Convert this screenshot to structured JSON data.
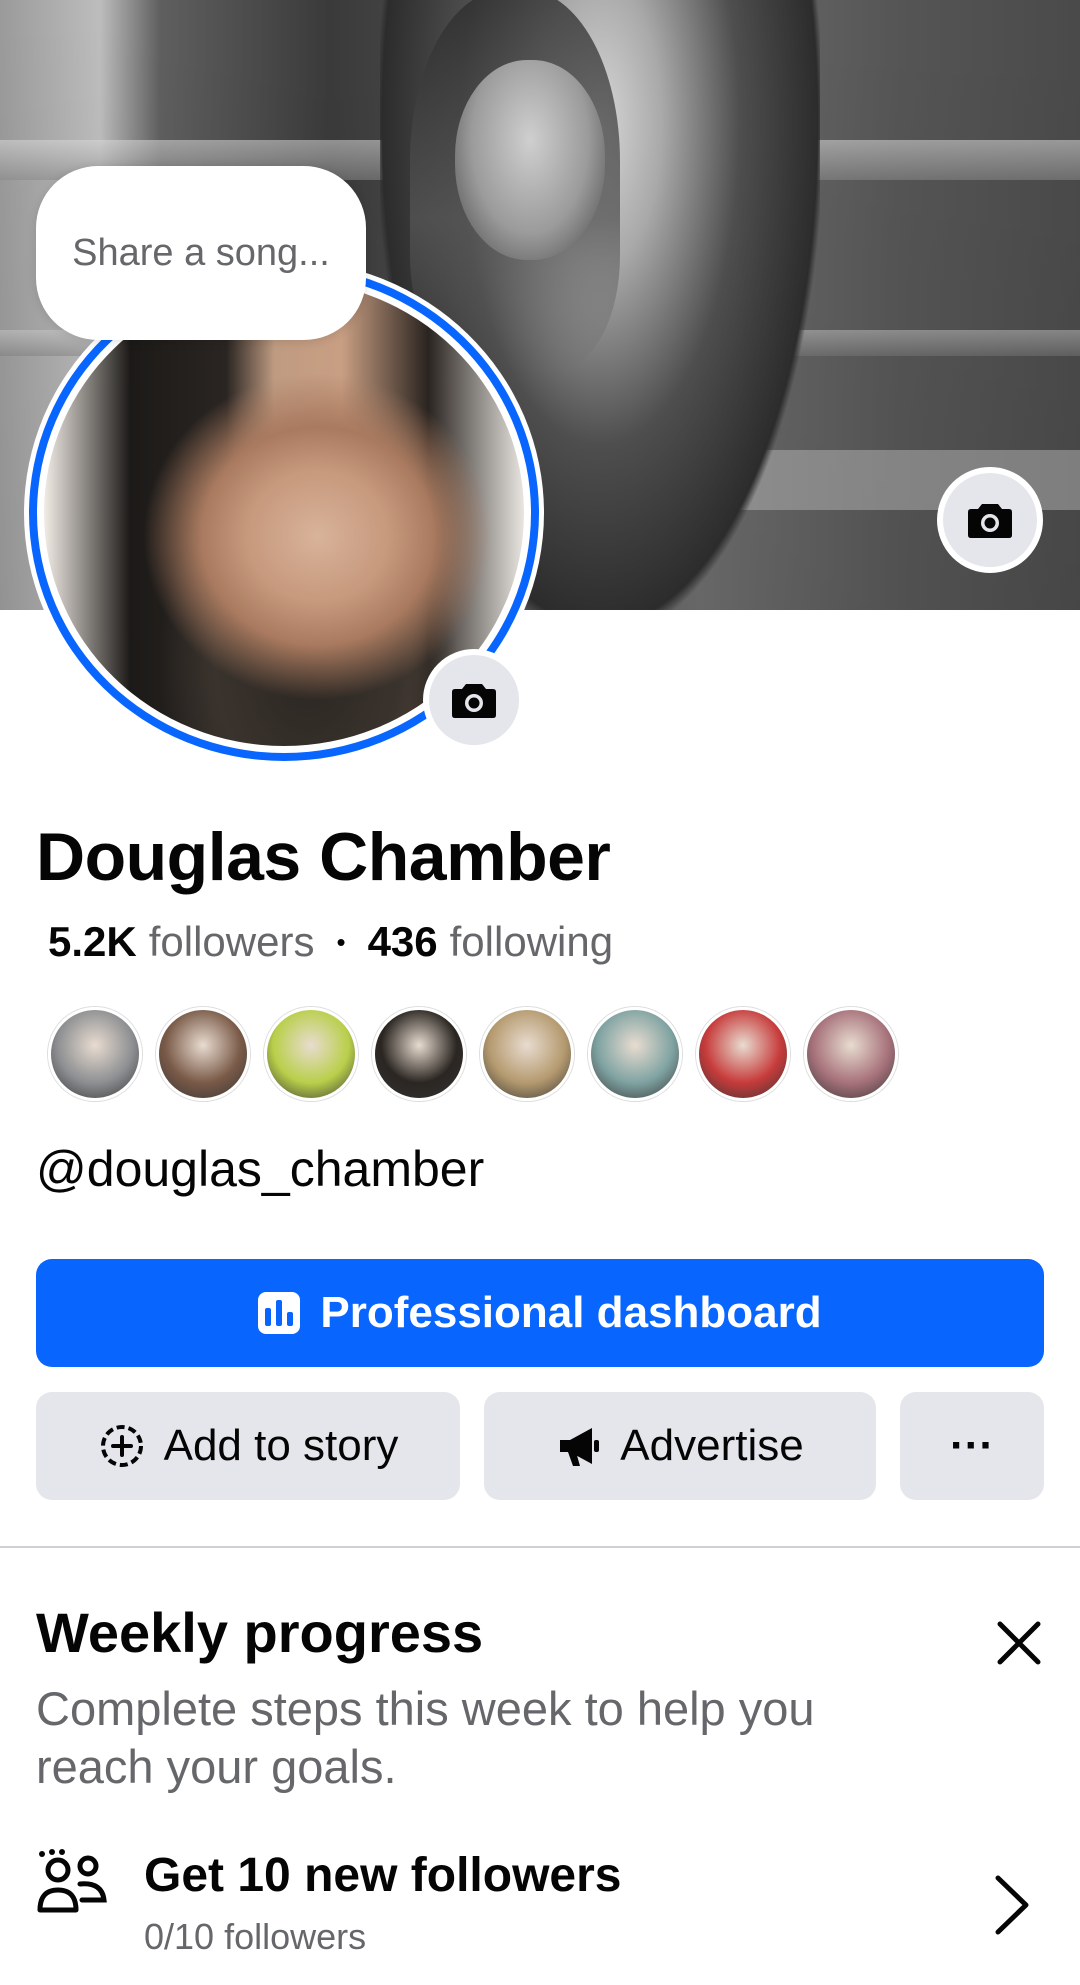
{
  "profile": {
    "note_placeholder": "Share a song...",
    "name": "Douglas Chamber",
    "followers_count": "5.2K",
    "followers_label": "followers",
    "following_count": "436",
    "following_label": "following",
    "handle": "@douglas_chamber",
    "friend_avatars": [
      {
        "name": "friend-avatar-1",
        "color": "#8d8f92"
      },
      {
        "name": "friend-avatar-2",
        "color": "#7a5a48"
      },
      {
        "name": "friend-avatar-3",
        "color": "#b9cf4a"
      },
      {
        "name": "friend-avatar-4",
        "color": "#2b2622"
      },
      {
        "name": "friend-avatar-5",
        "color": "#b59a6f"
      },
      {
        "name": "friend-avatar-6",
        "color": "#7fa3a2"
      },
      {
        "name": "friend-avatar-7",
        "color": "#c73b3b"
      },
      {
        "name": "friend-avatar-8",
        "color": "#a7727b"
      }
    ]
  },
  "actions": {
    "professional_dashboard": "Professional dashboard",
    "add_to_story": "Add to story",
    "advertise": "Advertise",
    "more": "···"
  },
  "weekly_progress": {
    "title": "Weekly progress",
    "description": "Complete steps this week to help you reach your goals.",
    "task_title": "Get 10 new followers",
    "task_progress": "0/10 followers"
  },
  "colors": {
    "accent": "#0866ff",
    "secondary_button": "#e4e6eb",
    "muted_text": "#65676b"
  }
}
